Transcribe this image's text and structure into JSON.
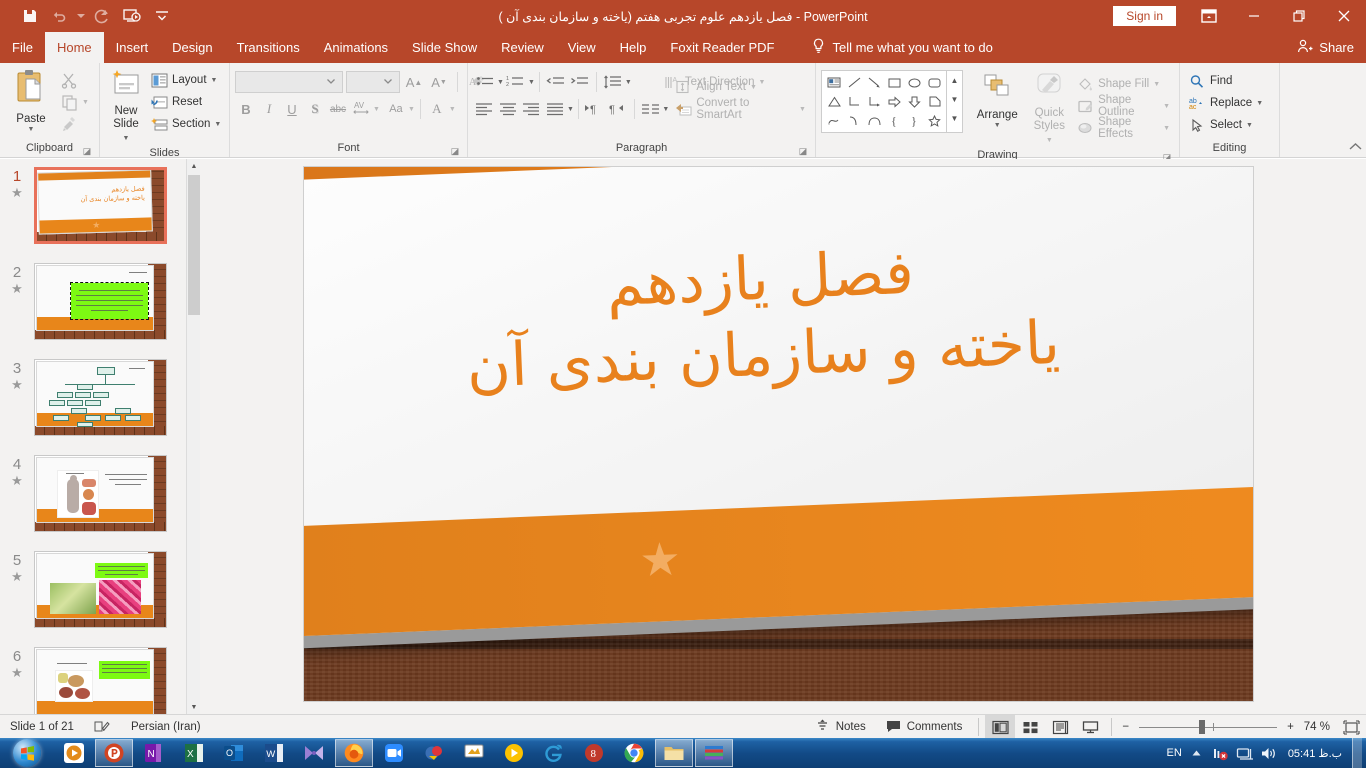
{
  "titlebar": {
    "document_title": "فصل یازدهم علوم تجربی هفتم (یاخته و سازمان بندی آن )  -  PowerPoint",
    "quick_access": [
      {
        "name": "save-icon",
        "label": "Save"
      },
      {
        "name": "undo-icon",
        "label": "Undo"
      },
      {
        "name": "redo-icon",
        "label": "Redo"
      },
      {
        "name": "start-from-beginning-icon",
        "label": "Start From Beginning"
      },
      {
        "name": "customize-quick-access-toolbar-icon",
        "label": "Customize Quick Access Toolbar"
      }
    ],
    "sign_in": "Sign in",
    "ribbon_display_options": "Ribbon Display Options",
    "minimize": "Minimize",
    "restore": "Restore Down",
    "close": "Close"
  },
  "tabs": [
    {
      "label": "File",
      "active": false
    },
    {
      "label": "Home",
      "active": true
    },
    {
      "label": "Insert",
      "active": false
    },
    {
      "label": "Design",
      "active": false
    },
    {
      "label": "Transitions",
      "active": false
    },
    {
      "label": "Animations",
      "active": false
    },
    {
      "label": "Slide Show",
      "active": false
    },
    {
      "label": "Review",
      "active": false
    },
    {
      "label": "View",
      "active": false
    },
    {
      "label": "Help",
      "active": false
    },
    {
      "label": "Foxit Reader PDF",
      "active": false
    }
  ],
  "tell_me": "Tell me what you want to do",
  "share": "Share",
  "ribbon": {
    "clipboard": {
      "label": "Clipboard",
      "paste": "Paste",
      "cut": "Cut",
      "copy": "Copy",
      "format_painter": "Format Painter"
    },
    "slides": {
      "label": "Slides",
      "new_slide": "New\nSlide",
      "new_slide_line1": "New",
      "new_slide_line2": "Slide",
      "layout": "Layout",
      "reset": "Reset",
      "section": "Section"
    },
    "font": {
      "label": "Font",
      "font_name_value": "",
      "font_size_value": "",
      "increase_font_size": "Increase Font Size",
      "decrease_font_size": "Decrease Font Size",
      "clear_formatting": "Clear All Formatting",
      "bold": "B",
      "italic": "I",
      "underline": "U",
      "shadow": "S",
      "strikethrough": "abc",
      "character_spacing": "AV",
      "change_case": "Aa",
      "font_color": "A"
    },
    "paragraph": {
      "label": "Paragraph",
      "bullets": "Bullets",
      "numbering": "Numbering",
      "decrease_indent": "Decrease List Level",
      "increase_indent": "Increase List Level",
      "line_spacing": "Line Spacing",
      "align_left": "Align Left",
      "center": "Center",
      "align_right": "Align Right",
      "justify": "Justify",
      "ltr": "Left-to-Right",
      "rtl": "Right-to-Left",
      "columns": "Columns",
      "text_direction": "Text Direction",
      "align_text": "Align Text",
      "convert_to_smartart": "Convert to SmartArt"
    },
    "drawing": {
      "label": "Drawing",
      "arrange": "Arrange",
      "quick_styles_line1": "Quick",
      "quick_styles_line2": "Styles",
      "shape_fill": "Shape Fill",
      "shape_outline": "Shape Outline",
      "shape_effects": "Shape Effects"
    },
    "editing": {
      "label": "Editing",
      "find": "Find",
      "replace": "Replace",
      "select": "Select"
    },
    "collapse_ribbon": "Collapse the Ribbon"
  },
  "thumbnails": [
    {
      "number": "1",
      "animated": true,
      "selected": true,
      "kind": "title"
    },
    {
      "number": "2",
      "animated": true,
      "selected": false,
      "kind": "green-text"
    },
    {
      "number": "3",
      "animated": true,
      "selected": false,
      "kind": "diagram"
    },
    {
      "number": "4",
      "animated": true,
      "selected": false,
      "kind": "body-figure"
    },
    {
      "number": "5",
      "animated": true,
      "selected": false,
      "kind": "two-images"
    },
    {
      "number": "6",
      "animated": true,
      "selected": false,
      "kind": "image-text"
    }
  ],
  "slide": {
    "title_line1": "فصل یازدهم",
    "title_line2": "یاخته و سازمان بندی آن",
    "accent_color": "#e8811d",
    "star_decoration": "★"
  },
  "statusbar": {
    "slide_counter": "Slide 1 of 21",
    "spelling_icon": "spell-check-icon",
    "language": "Persian (Iran)",
    "notes": "Notes",
    "comments": "Comments",
    "view_normal": "Normal",
    "view_slide_sorter": "Slide Sorter",
    "view_reading": "Reading View",
    "view_slide_show": "Slide Show",
    "zoom_out": "−",
    "zoom_in": "+",
    "zoom_level": "74 %",
    "fit_to_window": "Fit slide to current window"
  },
  "taskbar": {
    "start": "Start",
    "items": [
      {
        "name": "taskbar-media-player",
        "label": "Windows Media Player",
        "open": false
      },
      {
        "name": "taskbar-powerpoint",
        "label": "PowerPoint",
        "open": true
      },
      {
        "name": "taskbar-onenote",
        "label": "OneNote",
        "open": false
      },
      {
        "name": "taskbar-excel",
        "label": "Excel",
        "open": false
      },
      {
        "name": "taskbar-outlook",
        "label": "Outlook",
        "open": false
      },
      {
        "name": "taskbar-word",
        "label": "Word",
        "open": false
      },
      {
        "name": "taskbar-movie-maker",
        "label": "Movie Maker",
        "open": false
      },
      {
        "name": "taskbar-firefox",
        "label": "Firefox",
        "open": true
      },
      {
        "name": "taskbar-zoom",
        "label": "Zoom",
        "open": false
      },
      {
        "name": "taskbar-zarinpal",
        "label": "Zoom Meeting",
        "open": false
      },
      {
        "name": "taskbar-netsupport",
        "label": "NetSupport",
        "open": false
      },
      {
        "name": "taskbar-vlc",
        "label": "Media Player",
        "open": false
      },
      {
        "name": "taskbar-internet-explorer",
        "label": "Internet Explorer",
        "open": false
      },
      {
        "name": "taskbar-idm",
        "label": "Internet Download Manager",
        "open": false
      },
      {
        "name": "taskbar-chrome",
        "label": "Google Chrome",
        "open": false
      },
      {
        "name": "taskbar-file-explorer",
        "label": "File Explorer",
        "open": true
      },
      {
        "name": "taskbar-winrar",
        "label": "WinRAR",
        "open": true
      }
    ],
    "tray": {
      "language": "EN",
      "show_hidden": "Show hidden icons",
      "network": "Network",
      "action_center": "Action Center",
      "volume": "Volume",
      "clock": "05:41 ب.ظ"
    }
  }
}
